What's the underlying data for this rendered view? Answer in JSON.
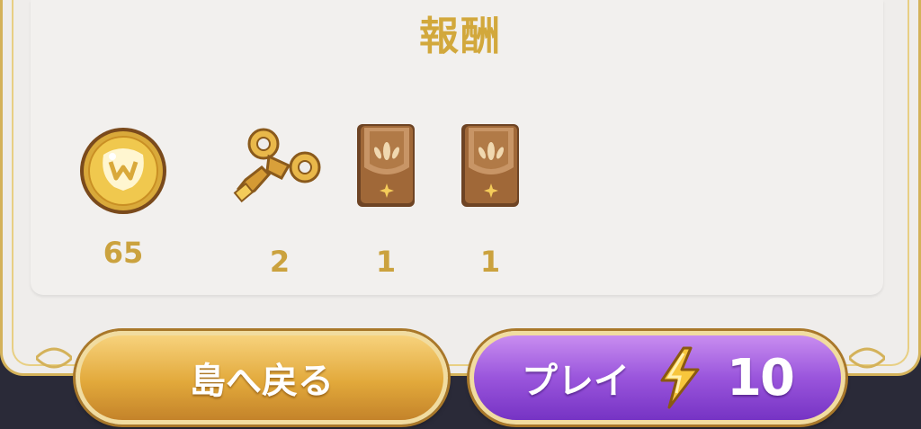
{
  "title": "報酬",
  "rewards": [
    {
      "icon": "coin-icon",
      "quantity": "65"
    },
    {
      "icon": "windup-key-icon",
      "quantity": "2"
    },
    {
      "icon": "card-pack-icon",
      "quantity": "1"
    },
    {
      "icon": "card-pack-icon",
      "quantity": "1"
    }
  ],
  "buttons": {
    "back_label": "島へ戻る",
    "play_label": "プレイ",
    "play_cost": "10",
    "play_cost_icon": "lightning-icon"
  },
  "colors": {
    "title_gold": "#d2a83c",
    "quantity_gold": "#cba23e",
    "back_button": "#e2a93b",
    "play_button": "#9a55dc",
    "frame_gold": "#d4b25a"
  }
}
